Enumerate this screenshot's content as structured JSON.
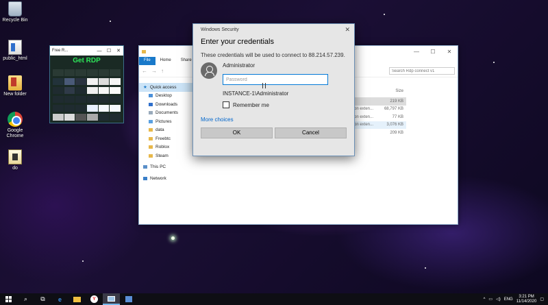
{
  "desktop": {
    "icons": [
      {
        "label": "Recycle Bin",
        "icon": "recycle-bin-icon"
      },
      {
        "label": "public_html",
        "icon": "file-icon"
      },
      {
        "label": "New folder",
        "icon": "folder-icon"
      },
      {
        "label": "Google Chrome",
        "icon": "chrome-icon"
      },
      {
        "label": "do",
        "icon": "file-icon"
      }
    ]
  },
  "rdp_window": {
    "title": "Free R...",
    "heading": "Get RDP"
  },
  "explorer": {
    "tabs": [
      "File",
      "Home",
      "Share"
    ],
    "search_placeholder": "Search Rdp connect v1",
    "sidebar": {
      "quick_access": "Quick access",
      "items": [
        "Desktop",
        "Downloads",
        "Documents",
        "Pictures",
        "data",
        "Freebtc",
        "Roblox",
        "Steam"
      ],
      "this_pc": "This PC",
      "network": "Network"
    },
    "size_header": "Size",
    "files": [
      {
        "type": "",
        "size": "219 KB"
      },
      {
        "type": "on exten...",
        "size": "68,797 KB"
      },
      {
        "type": "on exten...",
        "size": "77 KB"
      },
      {
        "type": "on exten...",
        "size": "3,076 KB"
      },
      {
        "type": "",
        "size": "209 KB"
      }
    ]
  },
  "dialog": {
    "window_title": "Windows Security",
    "heading": "Enter your credentials",
    "subtext": "These credentials will be used to connect to 88.214.57.239.",
    "username": "Administrator",
    "password_placeholder": "Password",
    "domain_user": "INSTANCE-1\\Administrator",
    "remember_label": "Remember me",
    "more_choices": "More choices",
    "ok_label": "OK",
    "cancel_label": "Cancel"
  },
  "taskbar": {
    "language": "ENG",
    "time": "3:21 PM",
    "date": "11/14/2020"
  }
}
